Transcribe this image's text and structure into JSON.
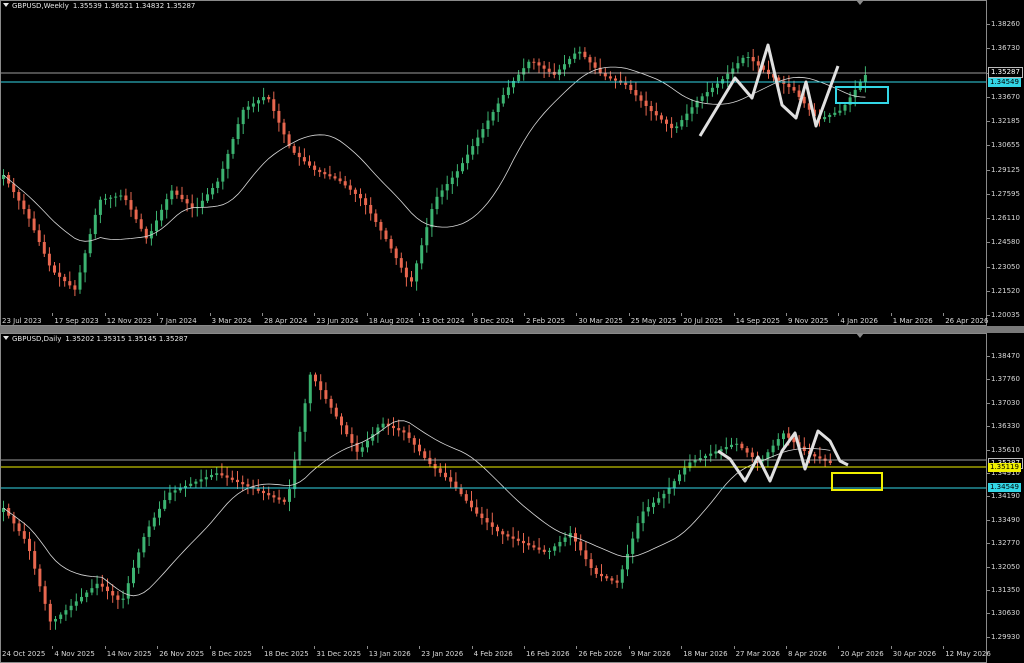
{
  "colors": {
    "bull": "#3cb371",
    "bear": "#e8674f",
    "ma": "#d9d9d9",
    "cyan": "#33d6e6",
    "yellow": "#f0f000",
    "white": "#ffffff",
    "pattern": "#e0e0e0"
  },
  "weekly": {
    "symbol": "GBPUSD,Weekly",
    "ohlc": "1.35539 1.36521 1.34832 1.35287",
    "price_tags": {
      "current": "1.35287",
      "level": "1.34549"
    },
    "y_ticks": [
      "1.38260",
      "1.36730",
      "1.35200",
      "1.33670",
      "1.32185",
      "1.30655",
      "1.29125",
      "1.27595",
      "1.26110",
      "1.24580",
      "1.23050",
      "1.21520",
      "1.20035"
    ],
    "x_ticks": [
      "23 Jul 2023",
      "17 Sep 2023",
      "12 Nov 2023",
      "7 Jan 2024",
      "3 Mar 2024",
      "28 Apr 2024",
      "23 Jun 2024",
      "18 Aug 2024",
      "13 Oct 2024",
      "8 Dec 2024",
      "2 Feb 2025",
      "30 Mar 2025",
      "25 May 2025",
      "20 Jul 2025",
      "14 Sep 2025",
      "9 Nov 2025",
      "4 Jan 2026",
      "1 Mar 2026",
      "26 Apr 2026"
    ]
  },
  "daily": {
    "symbol": "GBPUSD,Daily",
    "ohlc": "1.35202 1.35315 1.35145 1.35287",
    "price_tags": {
      "current": "1.35287",
      "yellow": "1.35119",
      "cyan": "1.34549"
    },
    "y_ticks": [
      "1.38470",
      "1.37760",
      "1.37030",
      "1.36330",
      "1.35610",
      "1.34910",
      "1.34190",
      "1.33490",
      "1.32770",
      "1.32050",
      "1.31350",
      "1.30630",
      "1.29930"
    ],
    "x_ticks": [
      "24 Oct 2025",
      "4 Nov 2025",
      "14 Nov 2025",
      "26 Nov 2025",
      "8 Dec 2025",
      "18 Dec 2025",
      "31 Dec 2025",
      "13 Jan 2026",
      "23 Jan 2026",
      "4 Feb 2026",
      "16 Feb 2026",
      "26 Feb 2026",
      "9 Mar 2026",
      "18 Mar 2026",
      "27 Mar 2026",
      "8 Apr 2026",
      "20 Apr 2026",
      "30 Apr 2026",
      "12 May 2026"
    ]
  }
}
